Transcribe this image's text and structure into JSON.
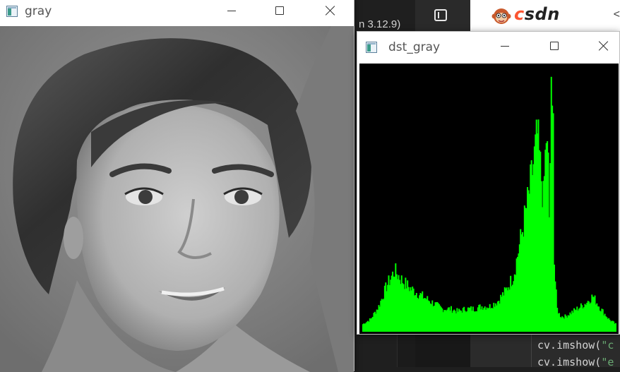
{
  "background": {
    "ide_title_fragment": "n 3.12.9)",
    "browser": {
      "logo_text_accent": "c",
      "logo_text_rest": "sdn",
      "tab_arrow": "<"
    },
    "code_lines": [
      {
        "prefix": "cv.imshow(",
        "string": "\"c"
      },
      {
        "prefix": "cv.imshow(",
        "string": "\"e"
      }
    ]
  },
  "windows": {
    "gray": {
      "title": "gray",
      "content": "grayscale portrait photo"
    },
    "dst_gray": {
      "title": "dst_gray",
      "histogram_color": "#00ff00",
      "background_color": "#000000"
    }
  },
  "chart_data": {
    "type": "bar",
    "title": "",
    "xlabel": "",
    "ylabel": "",
    "x_range": [
      0,
      255
    ],
    "color": "#00ff00",
    "note_values_normalized": "relative bin heights, 0-1 of histogram canvas",
    "x": [
      0,
      8,
      16,
      24,
      32,
      40,
      48,
      56,
      64,
      72,
      80,
      88,
      96,
      104,
      112,
      120,
      128,
      136,
      144,
      152,
      160,
      168,
      176,
      182,
      186,
      188,
      190,
      192,
      194,
      196,
      198,
      200,
      204,
      208,
      216,
      224,
      232,
      240,
      248,
      255
    ],
    "values": [
      0.03,
      0.05,
      0.1,
      0.18,
      0.24,
      0.2,
      0.17,
      0.15,
      0.13,
      0.11,
      0.09,
      0.09,
      0.08,
      0.09,
      0.09,
      0.1,
      0.1,
      0.12,
      0.16,
      0.22,
      0.38,
      0.55,
      0.77,
      0.52,
      0.85,
      0.45,
      0.9,
      0.35,
      0.2,
      0.09,
      0.07,
      0.06,
      0.06,
      0.07,
      0.09,
      0.11,
      0.14,
      0.09,
      0.05,
      0.03
    ]
  }
}
